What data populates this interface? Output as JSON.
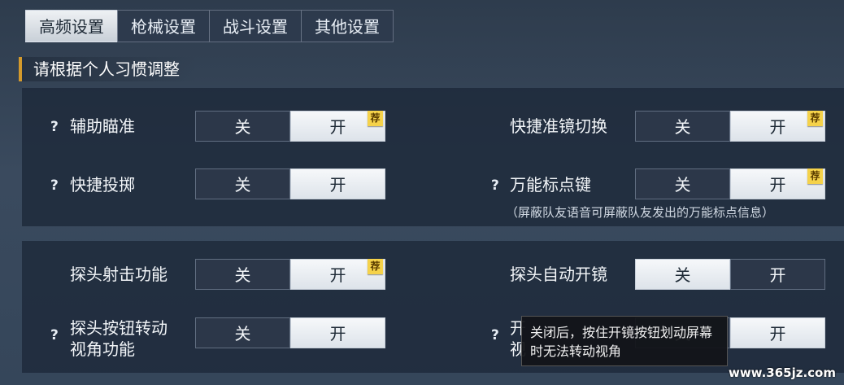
{
  "tabs": [
    {
      "label": "高频设置",
      "active": true
    },
    {
      "label": "枪械设置",
      "active": false
    },
    {
      "label": "战斗设置",
      "active": false
    },
    {
      "label": "其他设置",
      "active": false
    }
  ],
  "section_title": "请根据个人习惯调整",
  "help_mark": "?",
  "off_label": "关",
  "on_label": "开",
  "recommend_badge": "荐",
  "settings": {
    "aim_assist": {
      "label": "辅助瞄准",
      "selected": "开"
    },
    "quick_scope_switch": {
      "label": "快捷准镜切换",
      "selected": "开"
    },
    "quick_throw": {
      "label": "快捷投掷",
      "selected": "开"
    },
    "universal_marker": {
      "label": "万能标点键",
      "selected": "开",
      "hint": "（屏蔽队友语音可屏蔽队友发出的万能标点信息）"
    },
    "peek_fire": {
      "label": "探头射击功能",
      "selected": "开"
    },
    "peek_auto_scope": {
      "label": "探头自动开镜",
      "selected": "关"
    },
    "peek_button_view_line1": "探头按钮转动",
    "peek_button_view_line2": "视角功能",
    "peek_button_view_selected": "开",
    "hidden_row_char1": "开",
    "hidden_row_char2": "视",
    "hidden_row_selected": "开"
  },
  "tooltip": "关闭后，按住开镜按钮划动屏幕时无法转动视角",
  "watermark": "www.365jz.com"
}
